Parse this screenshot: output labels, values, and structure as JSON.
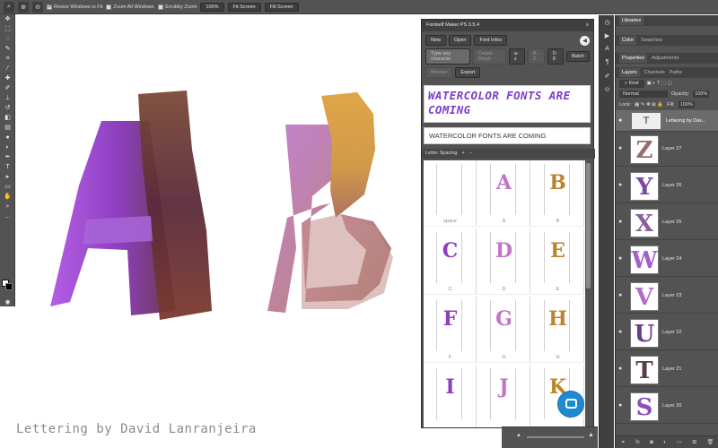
{
  "options_bar": {
    "resize_windows": "Resize Windows to Fit",
    "zoom_all": "Zoom All Windows",
    "scrubby_zoom": "Scrubby Zoom",
    "zoom_level": "100%",
    "fit_screen": "Fit Screen",
    "fill_screen": "Fill Screen"
  },
  "canvas": {
    "letters": [
      "A",
      "B"
    ],
    "credit": "Lettering by David Lanranjeira"
  },
  "fontself": {
    "title": "Fontself Maker PS 0.5.4",
    "buttons": {
      "new": "New",
      "open": "Open",
      "font_infos": "Font Infos"
    },
    "type_placeholder": "Type any character",
    "create_glyph": "Create Glyph",
    "case_lower": "a-z",
    "case_upper": "A-Z",
    "digits": "0-9",
    "batch": "Batch",
    "browse": "Browse",
    "export": "Export",
    "preview": "WATERCOLOR FONTS ARE COMING",
    "input_value": "WATERCOLOR FONTS ARE COMING",
    "letter_spacing": "Letter Spacing",
    "grid": [
      {
        "label": "space",
        "glyph": ""
      },
      {
        "label": "A",
        "glyph": "A"
      },
      {
        "label": "B",
        "glyph": "B"
      },
      {
        "label": "C",
        "glyph": "C"
      },
      {
        "label": "D",
        "glyph": "D"
      },
      {
        "label": "E",
        "glyph": "E"
      },
      {
        "label": "F",
        "glyph": "F"
      },
      {
        "label": "G",
        "glyph": "G"
      },
      {
        "label": "H",
        "glyph": "H"
      },
      {
        "label": "",
        "glyph": "I"
      },
      {
        "label": "",
        "glyph": "J"
      },
      {
        "label": "",
        "glyph": "K"
      }
    ]
  },
  "panels": {
    "libraries": "Libraries",
    "color_tab": "Color",
    "swatches_tab": "Swatches",
    "properties_tab": "Properties",
    "adjustments_tab": "Adjustments",
    "layers_tab": "Layers",
    "channels_tab": "Channels",
    "paths_tab": "Paths",
    "kind": "Kind",
    "blend_mode": "Normal",
    "opacity_label": "Opacity:",
    "opacity": "100%",
    "lock_label": "Lock:",
    "fill_label": "Fill:",
    "fill": "100%",
    "text_layer": "Lettering by Dav...",
    "layers": [
      {
        "name": "Layer 27",
        "glyph": "Z"
      },
      {
        "name": "Layer 26",
        "glyph": "Y"
      },
      {
        "name": "Layer 25",
        "glyph": "X"
      },
      {
        "name": "Layer 24",
        "glyph": "W"
      },
      {
        "name": "Layer 23",
        "glyph": "V"
      },
      {
        "name": "Layer 22",
        "glyph": "U"
      },
      {
        "name": "Layer 21",
        "glyph": "T"
      },
      {
        "name": "Layer 20",
        "glyph": "S"
      }
    ]
  },
  "colors": {
    "purple": "#a552d8",
    "brown": "#7a3f2a",
    "orange": "#d99a3a",
    "accent_blue": "#1d8ad6"
  }
}
